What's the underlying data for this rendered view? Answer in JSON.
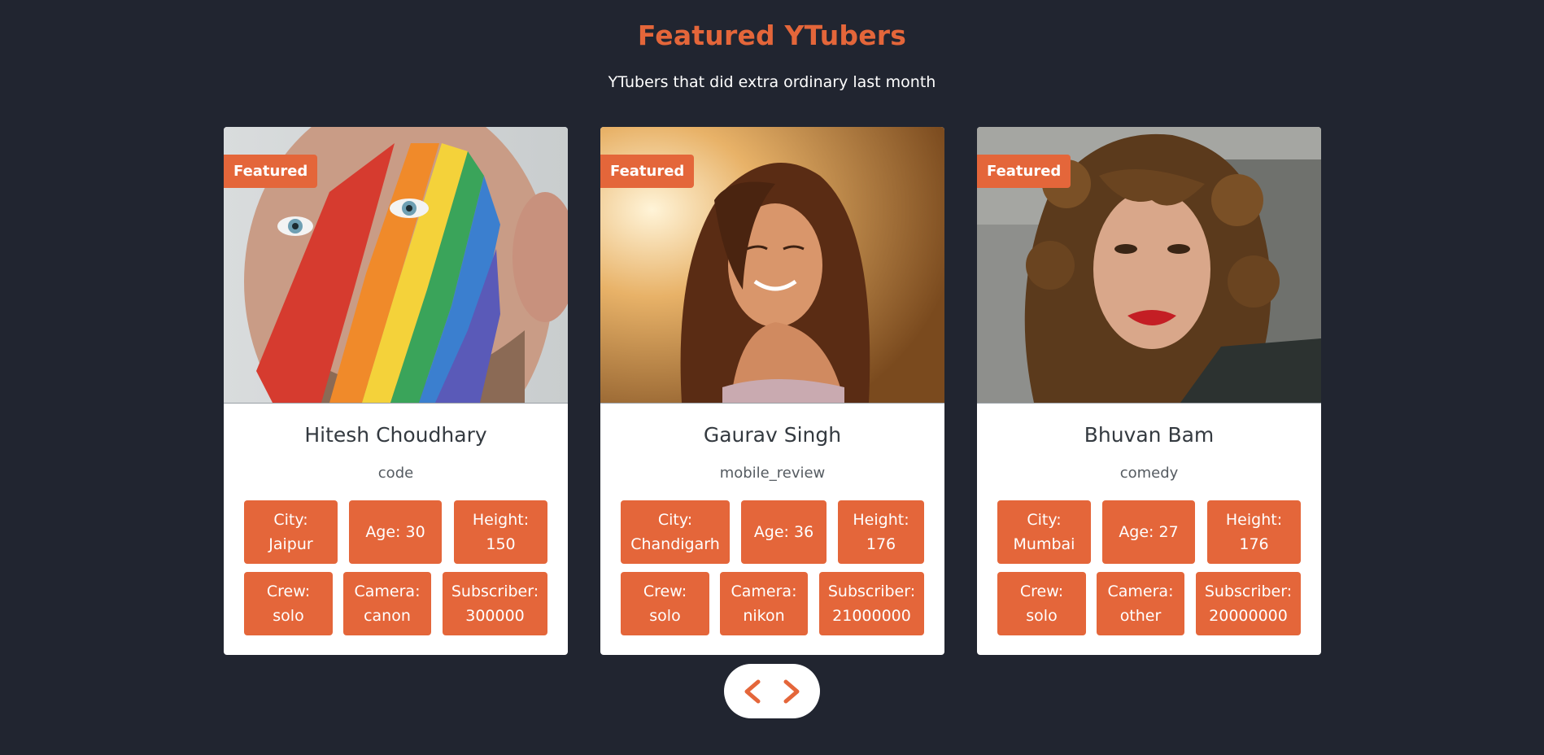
{
  "header": {
    "title": "Featured YTubers",
    "subtitle": "YTubers that did extra ordinary last month"
  },
  "theme": {
    "accent": "#e4663a",
    "background": "#212530"
  },
  "cards": [
    {
      "badge": "Featured",
      "name": "Hitesh Choudhary",
      "category": "code",
      "photo_subject": "man-with-rainbow-face-paint",
      "stats_row1": [
        {
          "label": "City:",
          "value": "Jaipur"
        },
        {
          "label": "Age: 30"
        },
        {
          "label": "Height:",
          "value": "150"
        }
      ],
      "stats_row2": [
        {
          "label": "Crew:",
          "value": "solo"
        },
        {
          "label": "Camera:",
          "value": "canon"
        },
        {
          "label": "Subscriber:",
          "value": "300000"
        }
      ]
    },
    {
      "badge": "Featured",
      "name": "Gaurav Singh",
      "category": "mobile_review",
      "photo_subject": "smiling-woman-sunset",
      "stats_row1": [
        {
          "label": "City:",
          "value": "Chandigarh"
        },
        {
          "label": "Age: 36"
        },
        {
          "label": "Height:",
          "value": "176"
        }
      ],
      "stats_row2": [
        {
          "label": "Crew:",
          "value": "solo"
        },
        {
          "label": "Camera:",
          "value": "nikon"
        },
        {
          "label": "Subscriber:",
          "value": "21000000"
        }
      ]
    },
    {
      "badge": "Featured",
      "name": "Bhuvan Bam",
      "category": "comedy",
      "photo_subject": "woman-curly-hair-red-lips",
      "stats_row1": [
        {
          "label": "City:",
          "value": "Mumbai"
        },
        {
          "label": "Age: 27"
        },
        {
          "label": "Height:",
          "value": "176"
        }
      ],
      "stats_row2": [
        {
          "label": "Crew:",
          "value": "solo"
        },
        {
          "label": "Camera:",
          "value": "other"
        },
        {
          "label": "Subscriber:",
          "value": "20000000"
        }
      ]
    }
  ],
  "carousel": {
    "prev_icon": "chevron-left-icon",
    "next_icon": "chevron-right-icon"
  }
}
